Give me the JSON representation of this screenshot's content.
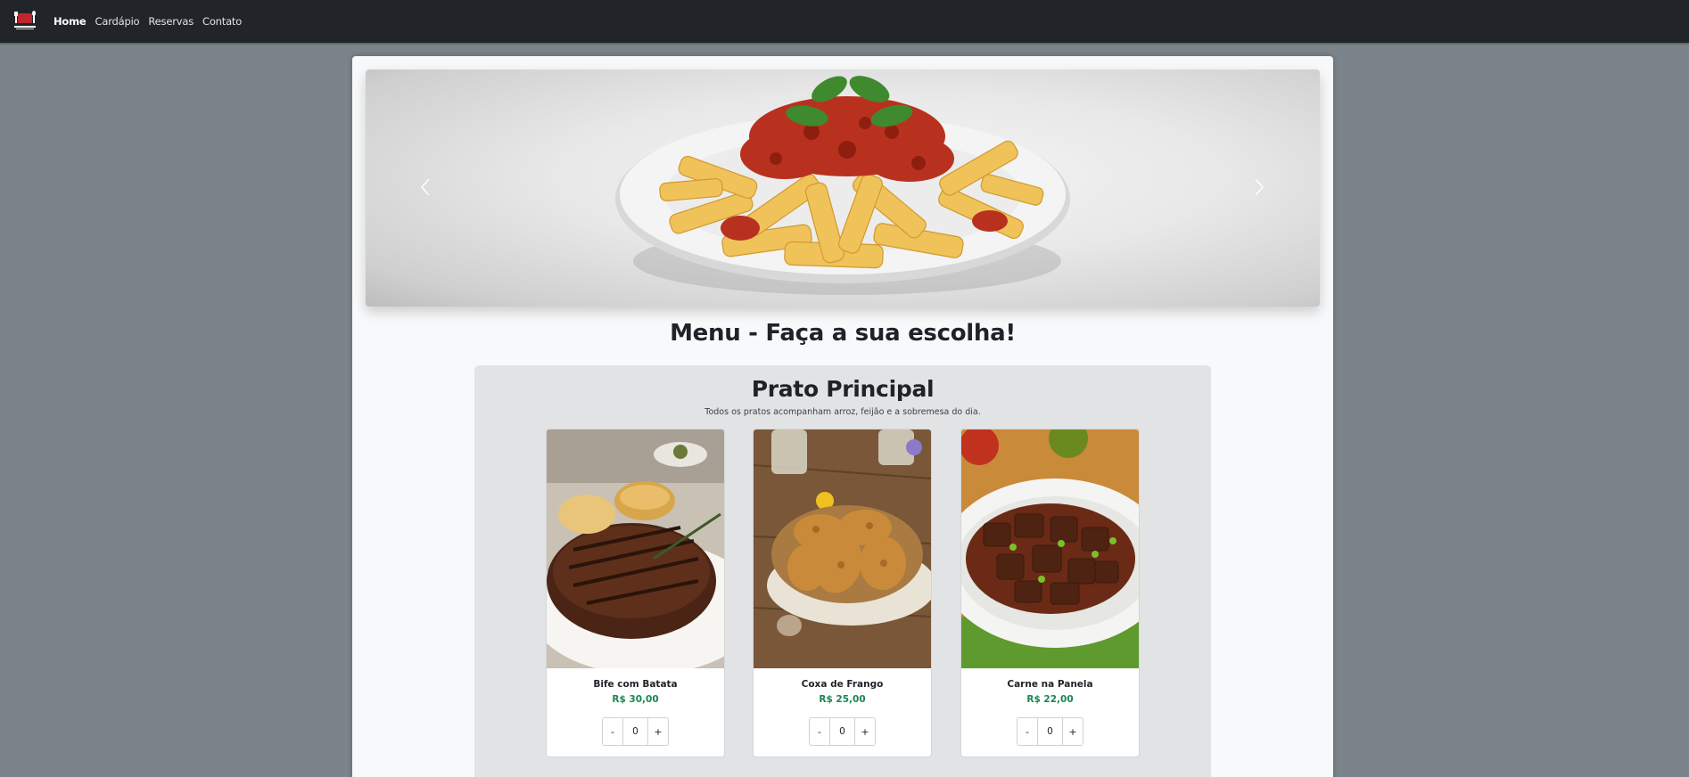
{
  "navbar": {
    "logo_icon": "restaurant-logo-icon",
    "links": [
      {
        "label": "Home",
        "active": true
      },
      {
        "label": "Cardápio",
        "active": false
      },
      {
        "label": "Reservas",
        "active": false
      },
      {
        "label": "Contato",
        "active": false
      }
    ]
  },
  "carousel": {
    "image": "penne-bolognese-plate",
    "prev_icon": "chevron-left-icon",
    "next_icon": "chevron-right-icon"
  },
  "menu": {
    "title": "Menu - Faça a sua escolha!"
  },
  "section": {
    "title": "Prato Principal",
    "subtitle": "Todos os pratos acompanham arroz, feijão e a sobremesa do dia.",
    "items": [
      {
        "name": "Bife com Batata",
        "price": "R$ 30,00",
        "quantity": "0",
        "minus": "-",
        "plus": "+",
        "image": "grilled-steak-photo"
      },
      {
        "name": "Coxa de Frango",
        "price": "R$ 25,00",
        "quantity": "0",
        "minus": "-",
        "plus": "+",
        "image": "fried-chicken-photo"
      },
      {
        "name": "Carne na Panela",
        "price": "R$ 22,00",
        "quantity": "0",
        "minus": "-",
        "plus": "+",
        "image": "beef-stew-photo"
      }
    ]
  },
  "colors": {
    "navbar_bg": "#212529",
    "page_bg": "#7b838b",
    "price_green": "#198754",
    "section_bg": "#e2e3e5"
  }
}
